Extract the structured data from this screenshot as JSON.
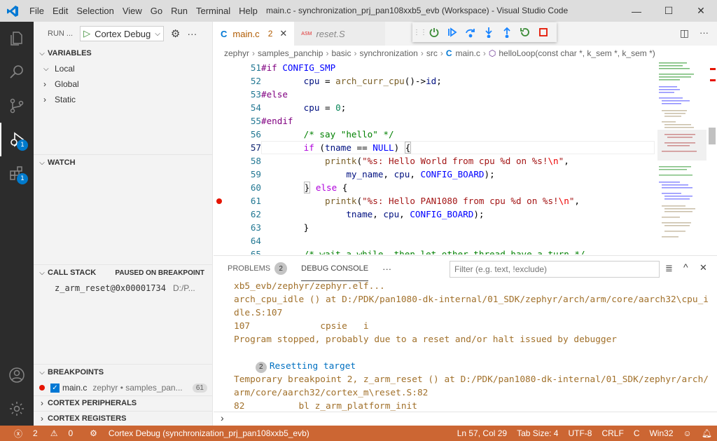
{
  "titlebar": {
    "menu": [
      "File",
      "Edit",
      "Selection",
      "View",
      "Go",
      "Run",
      "Terminal",
      "Help"
    ],
    "title": "main.c - synchronization_prj_pan108xxb5_evb (Workspace) - Visual Studio Code"
  },
  "activitybar": {
    "debug_badge": "1",
    "extensions_badge": "1"
  },
  "sidebar": {
    "run_label": "RUN ...",
    "config": "Cortex Debug",
    "variables": {
      "header": "VARIABLES",
      "items": [
        "Local",
        "Global",
        "Static"
      ]
    },
    "watch": {
      "header": "WATCH"
    },
    "callstack": {
      "header": "CALL STACK",
      "status": "PAUSED ON BREAKPOINT",
      "frame": "z_arm_reset@0x00001734",
      "frame_path": "D:/P..."
    },
    "breakpoints": {
      "header": "BREAKPOINTS",
      "file": "main.c",
      "path": "zephyr • samples_pan...",
      "line": "61"
    },
    "peripherals": "CORTEX PERIPHERALS",
    "registers": "CORTEX REGISTERS"
  },
  "tabs": [
    {
      "label": "main.c",
      "problems": "2"
    },
    {
      "label": "reset.S",
      "prefix": "ASM"
    }
  ],
  "breadcrumb": [
    "zephyr",
    "samples_panchip",
    "basic",
    "synchronization",
    "src",
    "main.c",
    "helloLoop(const char *, k_sem *, k_sem *)"
  ],
  "code": {
    "lines": [
      "51",
      "52",
      "53",
      "54",
      "55",
      "56",
      "57",
      "58",
      "59",
      "60",
      "61",
      "62",
      "63",
      "64",
      "65"
    ],
    "breakpoint_line": "61",
    "current_line": "57"
  },
  "panel": {
    "tabs": [
      "PROBLEMS",
      "DEBUG CONSOLE"
    ],
    "problems_count": "2",
    "filter_placeholder": "Filter (e.g. text, !exclude)",
    "console": [
      "xb5_evb/zephyr/zephyr.elf...",
      "arch_cpu_idle () at D:/PDK/pan1080-dk-internal/01_SDK/zephyr/arch/arm/core/aarch32\\cpu_i",
      "dle.S:107",
      "107             cpsie   i",
      "Program stopped, probably due to a reset and/or halt issued by debugger",
      "Resetting target",
      "Temporary breakpoint 2, z_arm_reset () at D:/PDK/pan1080-dk-internal/01_SDK/zephyr/arch/",
      "arm/core/aarch32/cortex_m\\reset.S:82",
      "82          bl z_arm_platform_init"
    ],
    "resetting_badge": "2"
  },
  "statusbar": {
    "errors": "2",
    "warnings": "0",
    "debug": "Cortex Debug (synchronization_prj_pan108xxb5_evb)",
    "position": "Ln 57, Col 29",
    "tabsize": "Tab Size: 4",
    "encoding": "UTF-8",
    "eol": "CRLF",
    "language": "C",
    "platform": "Win32"
  }
}
